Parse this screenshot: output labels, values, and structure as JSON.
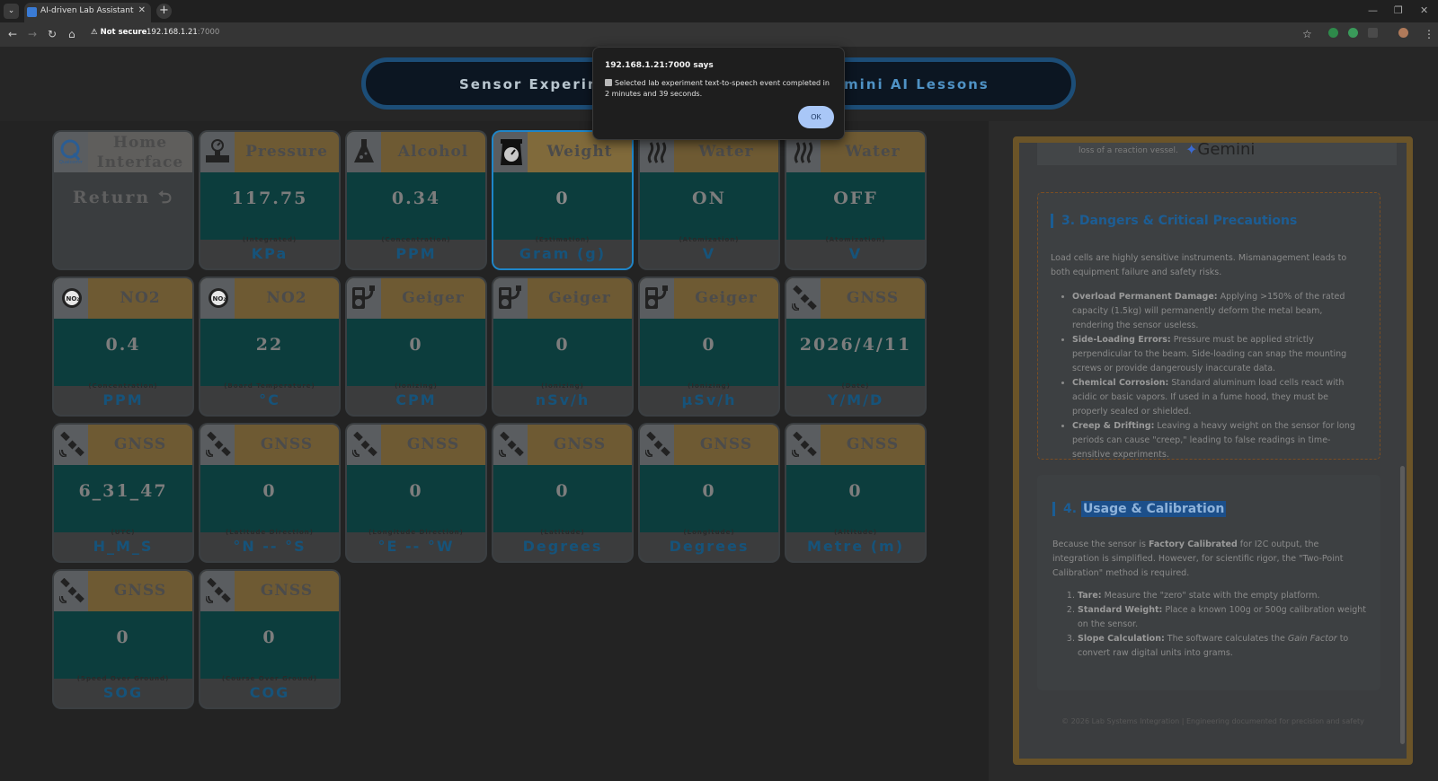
{
  "browser": {
    "tab_title": "AI-driven Lab Assistant",
    "tab_close": "✕",
    "new_tab": "+",
    "security_label": "Not secure",
    "url_host": "192.168.1.21",
    "url_port": ":7000",
    "win_min": "—",
    "win_max": "❐",
    "win_close": "✕"
  },
  "nav": {
    "left_label": "Sensor Experime",
    "right_label": "mini AI Lessons"
  },
  "cards": [
    {
      "title_line1": "Home",
      "title_line2": "Interface",
      "value": "Return ⮌",
      "sub": "",
      "unit": "",
      "icon": "qualcomm-icon"
    },
    {
      "title": "Pressure",
      "value": "117.75",
      "sub": "(Integrated)",
      "unit": "KPa",
      "icon": "pressure-gauge-icon"
    },
    {
      "title": "Alcohol",
      "value": "0.34",
      "sub": "(Concentration)",
      "unit": "PPM",
      "icon": "alcohol-flask-icon"
    },
    {
      "title": "Weight",
      "value": "0",
      "sub": "(Estimation)",
      "unit": "Gram (g)",
      "icon": "weight-scale-icon"
    },
    {
      "title": "Water",
      "value": "ON",
      "sub": "(Atomization)",
      "unit": "V",
      "icon": "water-vapor-icon"
    },
    {
      "title": "Water",
      "value": "OFF",
      "sub": "(Atomization)",
      "unit": "V",
      "icon": "water-vapor-icon"
    },
    {
      "title": "NO2",
      "value": "0.4",
      "sub": "(Concentration)",
      "unit": "PPM",
      "icon": "no2-gear-icon"
    },
    {
      "title": "NO2",
      "value": "22",
      "sub": "(Board Temperature)",
      "unit": "°C",
      "icon": "no2-gear-icon"
    },
    {
      "title": "Geiger",
      "value": "0",
      "sub": "(Ionizing)",
      "unit": "CPM",
      "icon": "geiger-counter-icon"
    },
    {
      "title": "Geiger",
      "value": "0",
      "sub": "(Ionizing)",
      "unit": "nSv/h",
      "icon": "geiger-counter-icon"
    },
    {
      "title": "Geiger",
      "value": "0",
      "sub": "(Ionizing)",
      "unit": "µSv/h",
      "icon": "geiger-counter-icon"
    },
    {
      "title": "GNSS",
      "value": "2026/4/11",
      "sub": "(Date)",
      "unit": "Y/M/D",
      "icon": "satellite-icon"
    },
    {
      "title": "GNSS",
      "value": "6_31_47",
      "sub": "(UTC)",
      "unit": "H_M_S",
      "icon": "satellite-icon"
    },
    {
      "title": "GNSS",
      "value": "0",
      "sub": "(Latitude Direction)",
      "unit": "°N -- °S",
      "icon": "satellite-icon"
    },
    {
      "title": "GNSS",
      "value": "0",
      "sub": "(Longitude Direction)",
      "unit": "°E -- °W",
      "icon": "satellite-icon"
    },
    {
      "title": "GNSS",
      "value": "0",
      "sub": "(Latitude)",
      "unit": "Degrees",
      "icon": "satellite-icon"
    },
    {
      "title": "GNSS",
      "value": "0",
      "sub": "(Longitude)",
      "unit": "Degrees",
      "icon": "satellite-icon"
    },
    {
      "title": "GNSS",
      "value": "0",
      "sub": "(Altitude)",
      "unit": "Metre (m)",
      "icon": "satellite-icon"
    },
    {
      "title": "GNSS",
      "value": "0",
      "sub": "(Speed Over Ground)",
      "unit": "SOG",
      "icon": "satellite-icon"
    },
    {
      "title": "GNSS",
      "value": "0",
      "sub": "(Course Over Ground)",
      "unit": "COG",
      "icon": "satellite-icon"
    }
  ],
  "doc": {
    "top_text": "loss of a reaction vessel.",
    "gemini_label": "Gemini",
    "sec3_title": "3. Dangers & Critical Precautions",
    "sec3_intro": "Load cells are highly sensitive instruments. Mismanagement leads to both equipment failure and safety risks.",
    "sec3_items": [
      {
        "bold": "Overload Permanent Damage:",
        "text": " Applying >150% of the rated capacity (1.5kg) will permanently deform the metal beam, rendering the sensor useless."
      },
      {
        "bold": "Side-Loading Errors:",
        "text": " Pressure must be applied strictly perpendicular to the beam. Side-loading can snap the mounting screws or provide dangerously inaccurate data."
      },
      {
        "bold": "Chemical Corrosion:",
        "text": " Standard aluminum load cells react with acidic or basic vapors. If used in a fume hood, they must be properly sealed or shielded."
      },
      {
        "bold": "Creep & Drifting:",
        "text": " Leaving a heavy weight on the sensor for long periods can cause \"creep,\" leading to false readings in time-sensitive experiments."
      }
    ],
    "sec4_num": "4.",
    "sec4_title": "Usage & Calibration",
    "sec4_p1": "Because the sensor is ",
    "sec4_p_bold": "Factory Calibrated",
    "sec4_p2": " for I2C output, the integration is simplified. However, for scientific rigor, the \"Two-Point Calibration\" method is required.",
    "sec4_items": [
      {
        "bold": "Tare:",
        "text": " Measure the \"zero\" state with the empty platform."
      },
      {
        "bold": "Standard Weight:",
        "text": " Place a known 100g or 500g calibration weight on the sensor."
      },
      {
        "bold": "Slope Calculation:",
        "text": " The software calculates the ",
        "italic": "Gain Factor",
        "tail": " to convert raw digital units into grams."
      }
    ],
    "footer": "© 2026 Lab Systems Integration | Engineering documented for precision and safety"
  },
  "dialog": {
    "title": "192.168.1.21:7000 says",
    "message": "Selected lab experiment text-to-speech event completed in 2 minutes and 39 seconds.",
    "ok_label": "OK"
  }
}
